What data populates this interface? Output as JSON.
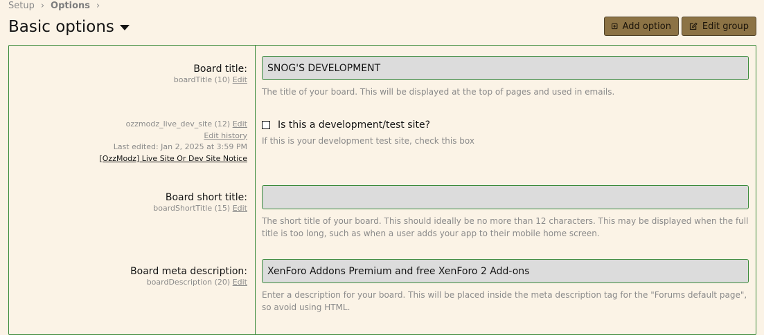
{
  "breadcrumb": {
    "items": [
      "Setup",
      "Options"
    ]
  },
  "page": {
    "title": "Basic options"
  },
  "actions": {
    "add_option": "Add option",
    "edit_group": "Edit group"
  },
  "colors": {
    "background": "#fbf3e6",
    "accent_border": "#3a8a3a",
    "button_bg": "#8c7345",
    "input_bg": "#dcdcdc",
    "muted_text": "#8a8a8a"
  },
  "options": [
    {
      "label": "Board title:",
      "id_text": "boardTitle (10)",
      "edit": "Edit",
      "value": "SNOG'S DEVELOPMENT",
      "hint": "The title of your board. This will be displayed at the top of pages and used in emails."
    },
    {
      "id_text": "ozzmodz_live_dev_site (12)",
      "edit": "Edit",
      "edit_history": "Edit history",
      "last_edited": "Last edited: Jan 2, 2025 at 3:59 PM",
      "addon": "[OzzModz] Live Site Or Dev Site Notice",
      "checkbox_label": "Is this a development/test site?",
      "checked": false,
      "hint": "If this is your development test site, check this box"
    },
    {
      "label": "Board short title:",
      "id_text": "boardShortTitle (15)",
      "edit": "Edit",
      "value": "",
      "hint": "The short title of your board. This should ideally be no more than 12 characters. This may be displayed when the full title is too long, such as when a user adds your app to their mobile home screen."
    },
    {
      "label": "Board meta description:",
      "id_text": "boardDescription (20)",
      "edit": "Edit",
      "value": "XenForo Addons Premium and free XenForo 2 Add-ons",
      "hint": "Enter a description for your board. This will be placed inside the meta description tag for the \"Forums default page\", so avoid using HTML."
    }
  ]
}
